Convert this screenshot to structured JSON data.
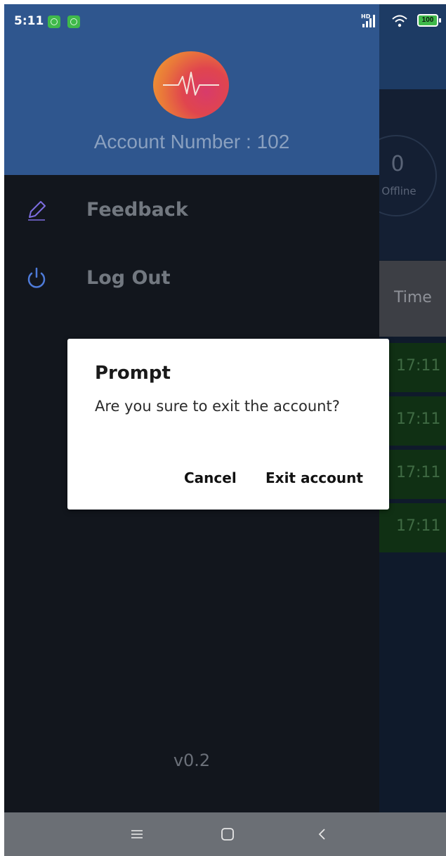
{
  "status_bar": {
    "time": "5:11",
    "battery": "100",
    "network": "HD",
    "icons": [
      "notification-app-icon",
      "notification-app-icon",
      "signal-icon",
      "wifi-icon",
      "battery-icon"
    ]
  },
  "background": {
    "offline_count": "0",
    "offline_label": "Offline",
    "time_header": "Time",
    "time_rows": [
      "17:11",
      "17:11",
      "17:11",
      "17:11"
    ]
  },
  "drawer": {
    "account_label": "Account Number : 102",
    "menu": [
      {
        "label": "Feedback",
        "icon": "pencil-icon"
      },
      {
        "label": "Log Out",
        "icon": "power-icon"
      }
    ],
    "version": "v0.2"
  },
  "dialog": {
    "title": "Prompt",
    "message": "Are you sure to exit the account?",
    "cancel_label": "Cancel",
    "confirm_label": "Exit account"
  },
  "colors": {
    "drawer_header": "#2f568e",
    "drawer_bg": "#12161d",
    "logo_gradient": [
      "#f0a52e",
      "#d83b6a"
    ],
    "power_icon": "#4e7bd9",
    "time_row_bg": "#103014"
  },
  "nav_bar": {
    "icons": [
      "menu-icon",
      "home-icon",
      "back-icon"
    ]
  }
}
